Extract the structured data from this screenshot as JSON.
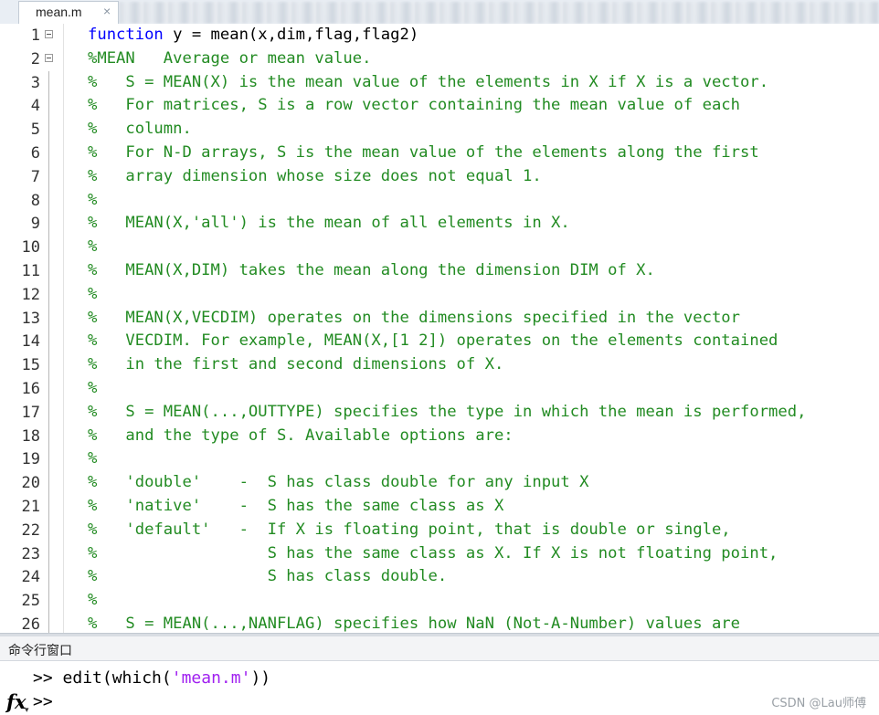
{
  "editor": {
    "tab_label": "mean.m",
    "tab_close": "×",
    "lines": [
      {
        "n": "1",
        "fold": true,
        "segs": [
          {
            "c": "kw",
            "t": "function"
          },
          {
            "c": "plain",
            "t": " y = mean(x,dim,flag,flag2)"
          }
        ]
      },
      {
        "n": "2",
        "fold": true,
        "segs": [
          {
            "c": "cm",
            "t": "%MEAN   Average or mean value."
          }
        ]
      },
      {
        "n": "3",
        "segs": [
          {
            "c": "cm",
            "t": "%   S = MEAN(X) is the mean value of the elements in X if X is a vector."
          }
        ]
      },
      {
        "n": "4",
        "segs": [
          {
            "c": "cm",
            "t": "%   For matrices, S is a row vector containing the mean value of each"
          }
        ]
      },
      {
        "n": "5",
        "segs": [
          {
            "c": "cm",
            "t": "%   column."
          }
        ]
      },
      {
        "n": "6",
        "segs": [
          {
            "c": "cm",
            "t": "%   For N-D arrays, S is the mean value of the elements along the first"
          }
        ]
      },
      {
        "n": "7",
        "segs": [
          {
            "c": "cm",
            "t": "%   array dimension whose size does not equal 1."
          }
        ]
      },
      {
        "n": "8",
        "segs": [
          {
            "c": "cm",
            "t": "%"
          }
        ]
      },
      {
        "n": "9",
        "segs": [
          {
            "c": "cm",
            "t": "%   MEAN(X,'all') is the mean of all elements in X."
          }
        ]
      },
      {
        "n": "10",
        "segs": [
          {
            "c": "cm",
            "t": "%"
          }
        ]
      },
      {
        "n": "11",
        "segs": [
          {
            "c": "cm",
            "t": "%   MEAN(X,DIM) takes the mean along the dimension DIM of X."
          }
        ]
      },
      {
        "n": "12",
        "segs": [
          {
            "c": "cm",
            "t": "%"
          }
        ]
      },
      {
        "n": "13",
        "segs": [
          {
            "c": "cm",
            "t": "%   MEAN(X,VECDIM) operates on the dimensions specified in the vector"
          }
        ]
      },
      {
        "n": "14",
        "segs": [
          {
            "c": "cm",
            "t": "%   VECDIM. For example, MEAN(X,[1 2]) operates on the elements contained"
          }
        ]
      },
      {
        "n": "15",
        "segs": [
          {
            "c": "cm",
            "t": "%   in the first and second dimensions of X."
          }
        ]
      },
      {
        "n": "16",
        "segs": [
          {
            "c": "cm",
            "t": "%"
          }
        ]
      },
      {
        "n": "17",
        "segs": [
          {
            "c": "cm",
            "t": "%   S = MEAN(...,OUTTYPE) specifies the type in which the mean is performed,"
          }
        ]
      },
      {
        "n": "18",
        "segs": [
          {
            "c": "cm",
            "t": "%   and the type of S. Available options are:"
          }
        ]
      },
      {
        "n": "19",
        "segs": [
          {
            "c": "cm",
            "t": "%"
          }
        ]
      },
      {
        "n": "20",
        "segs": [
          {
            "c": "cm",
            "t": "%   'double'    -  S has class double for any input X"
          }
        ]
      },
      {
        "n": "21",
        "segs": [
          {
            "c": "cm",
            "t": "%   'native'    -  S has the same class as X"
          }
        ]
      },
      {
        "n": "22",
        "segs": [
          {
            "c": "cm",
            "t": "%   'default'   -  If X is floating point, that is double or single,"
          }
        ]
      },
      {
        "n": "23",
        "segs": [
          {
            "c": "cm",
            "t": "%                  S has the same class as X. If X is not floating point,"
          }
        ]
      },
      {
        "n": "24",
        "segs": [
          {
            "c": "cm",
            "t": "%                  S has class double."
          }
        ]
      },
      {
        "n": "25",
        "segs": [
          {
            "c": "cm",
            "t": "%"
          }
        ]
      },
      {
        "n": "26",
        "segs": [
          {
            "c": "cm",
            "t": "%   S = MEAN(...,NANFLAG) specifies how NaN (Not-A-Number) values are"
          }
        ]
      }
    ]
  },
  "command_window": {
    "title": "命令行窗口",
    "history_prompt": ">> ",
    "history_cmd_pre": "edit(which(",
    "history_cmd_str": "'mean.m'",
    "history_cmd_post": "))",
    "prompt": ">>",
    "fx_label": "fx",
    "fx_caret": "▾"
  },
  "watermark": "CSDN @Lau师傅",
  "colors": {
    "keyword": "#0000ff",
    "comment": "#228b22",
    "string": "#a020f0",
    "text": "#000000"
  }
}
